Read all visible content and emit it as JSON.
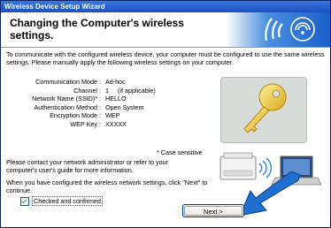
{
  "window": {
    "title": "Wireless Device Setup Wizard"
  },
  "header": {
    "title": "Changing the Computer's wireless settings."
  },
  "intro_text": "To communicate with the configured wireless device, your computer must be configured to use the same wireless settings. Please manually apply the following wireless settings on your computer.",
  "settings": [
    {
      "label": "Communication Mode :",
      "value": "Ad-hoc"
    },
    {
      "label": "Channel :",
      "value": "1     (if applicable)"
    },
    {
      "label": "Network Name (SSID)* :",
      "value": "HELLO"
    },
    {
      "label": "Authentication Method :",
      "value": "Open System"
    },
    {
      "label": "Encryption Mode :",
      "value": "WEP"
    },
    {
      "label": "WEP Key :",
      "value": "XXXXX"
    }
  ],
  "case_note": "* Case sensitive",
  "contact_text": "Please contact your network administrator or refer to your computer's user's guide for more information.",
  "when_text": "When you have configured the wireless network settings, click \"Next\" to continue.",
  "checkbox": {
    "label": "Checked and confirmed",
    "checked": true
  },
  "buttons": {
    "next": "Next >"
  },
  "colors": {
    "title_bar": "#1c4fc0",
    "header_band": "#1a5fc8",
    "arrow": "#1f6fd0"
  }
}
